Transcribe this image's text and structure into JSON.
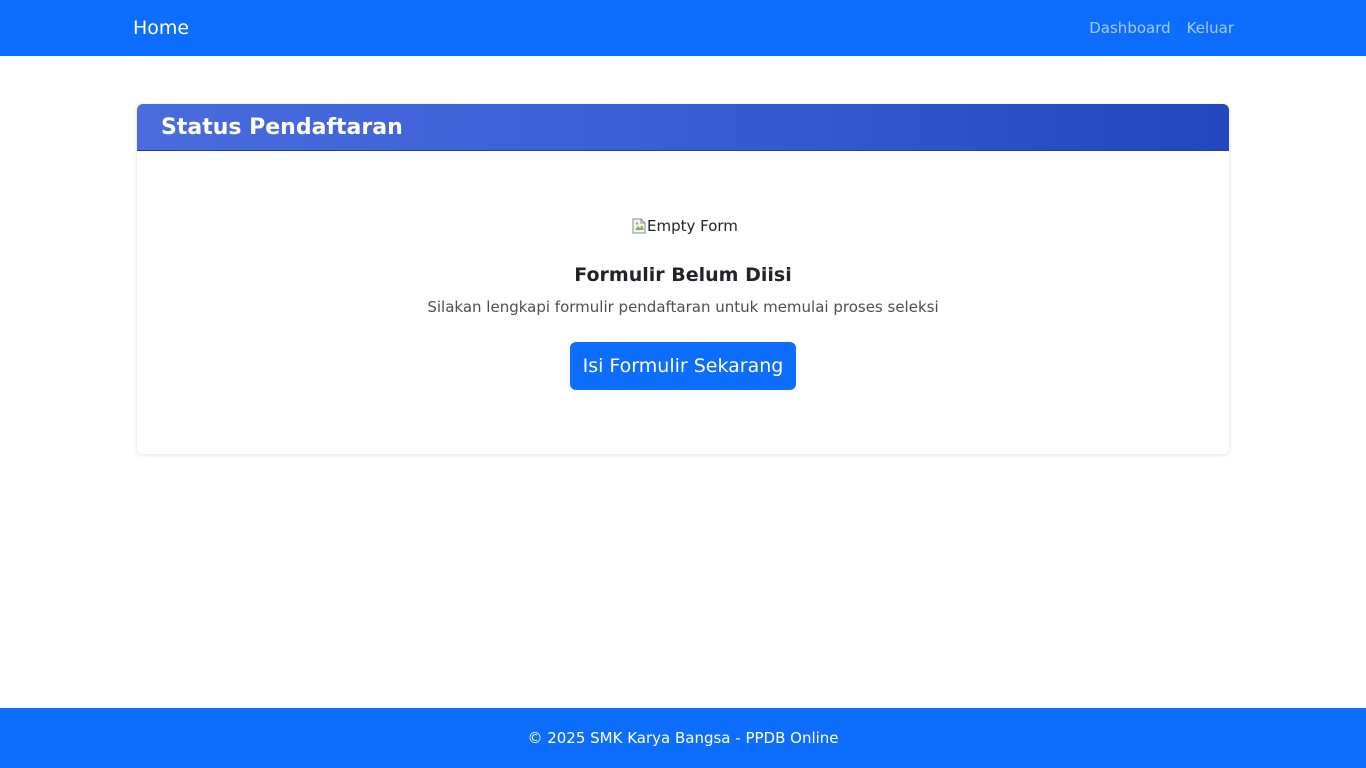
{
  "navbar": {
    "brand": "Home",
    "links": [
      "Dashboard",
      "Keluar"
    ]
  },
  "card": {
    "title": "Status Pendaftaran",
    "image_alt": "Empty Form",
    "empty_title": "Formulir Belum Diisi",
    "empty_description": "Silakan lengkapi formulir pendaftaran untuk memulai proses seleksi",
    "button_label": "Isi Formulir Sekarang"
  },
  "footer": {
    "text": "© 2025 SMK Karya Bangsa - PPDB Online"
  },
  "colors": {
    "primary": "#0d6efd",
    "header_gradient_start": "#4a6cdc",
    "header_gradient_end": "#2446bf"
  }
}
